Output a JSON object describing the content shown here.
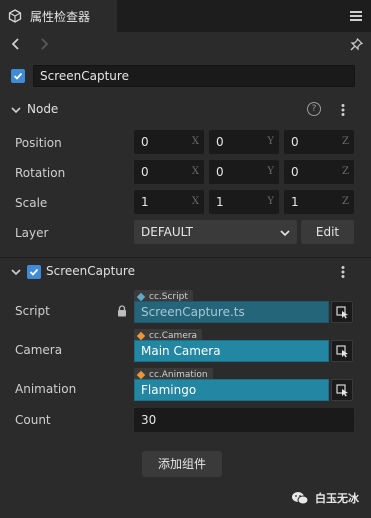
{
  "panel": {
    "tab_title": "属性检查器",
    "icon": "inspector-icon",
    "menu_icon": "hamburger-menu-icon"
  },
  "nav": {
    "back_icon": "chevron-left-icon",
    "forward_icon": "chevron-right-icon",
    "pin_icon": "pin-icon"
  },
  "node_name": {
    "enabled": true,
    "value": "ScreenCapture"
  },
  "node_section": {
    "title": "Node",
    "position": {
      "label": "Position",
      "x": "0",
      "y": "0",
      "z": "0"
    },
    "rotation": {
      "label": "Rotation",
      "x": "0",
      "y": "0",
      "z": "0"
    },
    "scale": {
      "label": "Scale",
      "x": "1",
      "y": "1",
      "z": "1"
    },
    "layer": {
      "label": "Layer",
      "value": "DEFAULT",
      "edit_label": "Edit"
    },
    "axis_labels": {
      "x": "X",
      "y": "Y",
      "z": "Z"
    }
  },
  "component": {
    "title": "ScreenCapture",
    "enabled": true,
    "script": {
      "label": "Script",
      "type": "cc.Script",
      "value": "ScreenCapture.ts"
    },
    "camera": {
      "label": "Camera",
      "type": "cc.Camera",
      "value": "Main Camera"
    },
    "animation": {
      "label": "Animation",
      "type": "cc.Animation",
      "value": "Flamingo"
    },
    "count": {
      "label": "Count",
      "value": "30"
    }
  },
  "add_component_label": "添加组件",
  "watermark": {
    "text": "白玉无冰"
  },
  "colors": {
    "accent": "#3f8bd6",
    "asset_bg": "#2386a3",
    "script_tag": "#5fa8c7",
    "ref_tag": "#e8963a"
  }
}
